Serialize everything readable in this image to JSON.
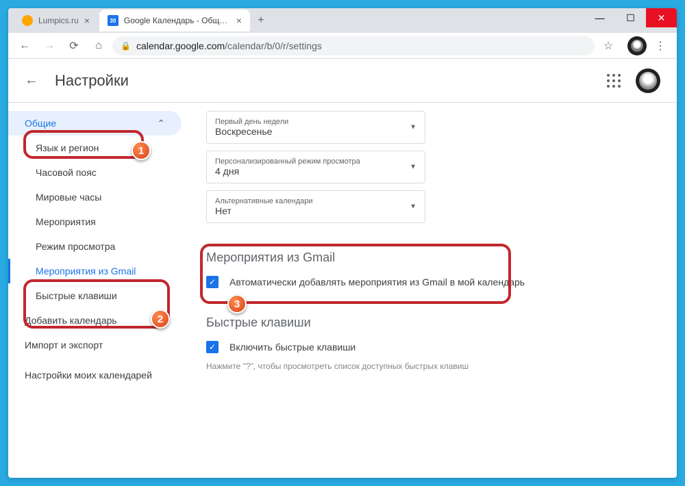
{
  "window": {
    "tabs": [
      {
        "title": "Lumpics.ru",
        "active": false
      },
      {
        "title": "Google Календарь - Общие нас",
        "active": true,
        "favicon_text": "30"
      }
    ],
    "url_domain": "calendar.google.com",
    "url_path": "/calendar/b/0/r/settings"
  },
  "header": {
    "title": "Настройки"
  },
  "sidebar": {
    "general": "Общие",
    "items": [
      "Язык и регион",
      "Часовой пояс",
      "Мировые часы",
      "Мероприятия",
      "Режим просмотра",
      "Мероприятия из Gmail",
      "Быстрые клавиши"
    ],
    "add_calendar": "Добавить календарь",
    "import_export": "Импорт и экспорт",
    "my_calendars_head": "Настройки моих календарей"
  },
  "main": {
    "selects": [
      {
        "label": "Первый день недели",
        "value": "Воскресенье"
      },
      {
        "label": "Персонализированный режим просмотра",
        "value": "4 дня"
      },
      {
        "label": "Альтернативные календари",
        "value": "Нет"
      }
    ],
    "gmail_section": {
      "title": "Мероприятия из Gmail",
      "checkbox_label": "Автоматически добавлять мероприятия из Gmail в мой календарь"
    },
    "shortcuts_section": {
      "title": "Быстрые клавиши",
      "checkbox_label": "Включить быстрые клавиши",
      "hint": "Нажмите \"?\", чтобы просмотреть список доступных быстрых клавиш"
    }
  },
  "callouts": {
    "n1": "1",
    "n2": "2",
    "n3": "3"
  }
}
